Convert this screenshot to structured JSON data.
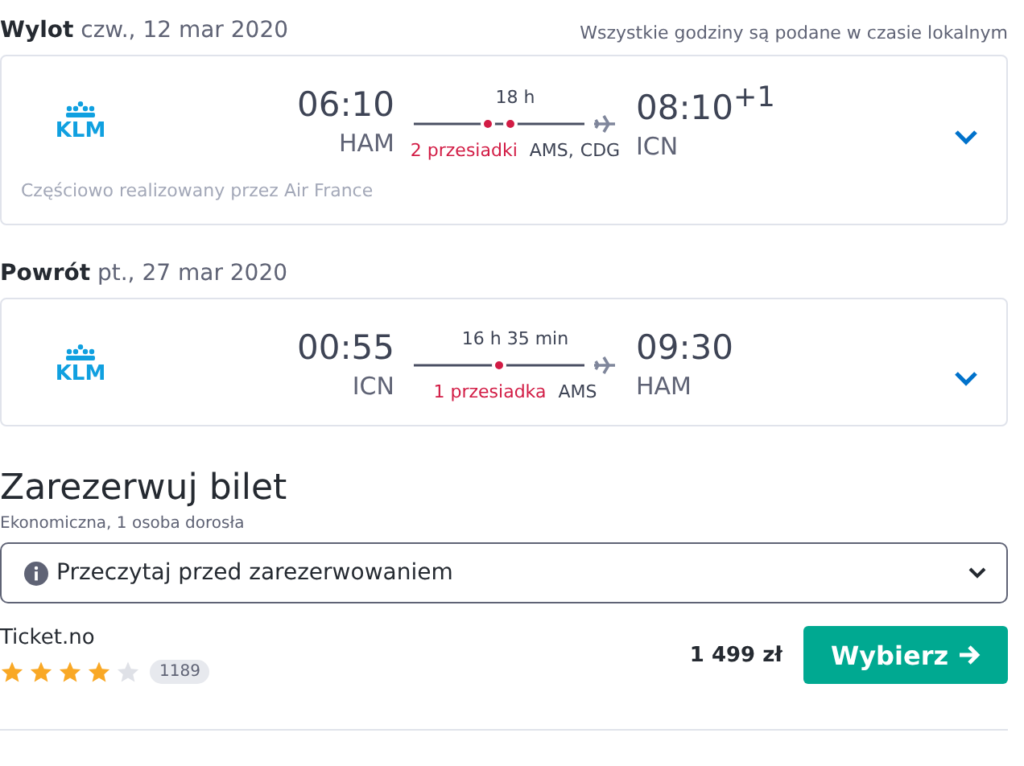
{
  "timezone_note": "Wszystkie godziny są podane w czasie lokalnym",
  "legs": [
    {
      "label": "Wylot",
      "date": "czw., 12 mar 2020",
      "airline": "KLM",
      "depart_time": "06:10",
      "depart_airport": "HAM",
      "duration": "18 h",
      "arrive_time": "08:10$^{+1}$",
      "arrive_airport": "ICN",
      "stops_text": "2 przesiadki",
      "stops": [
        "AMS,",
        "CDG"
      ],
      "operated_by": "Częściowo realizowany przez Air France",
      "expanded": false
    },
    {
      "label": "Powrót",
      "date": "pt., 27 mar 2020",
      "airline": "KLM",
      "depart_time": "00:55",
      "depart_airport": "ICN",
      "duration": "16 h 35 min",
      "arrive_time": "09:30",
      "arrive_airport": "HAM",
      "stops_text": "1 przesiadka",
      "stops": [
        "AMS"
      ],
      "expanded": false
    }
  ],
  "booking": {
    "title": "Zarezerwuj bilet",
    "subtitle": "Ekonomiczna, 1 osoba dorosła",
    "info": "Przeczytaj przed zarezerwowaniem",
    "provider": "Ticket.no",
    "stars": 4,
    "reviews": "1189",
    "price": "1 499 zł",
    "button": "Wybierz"
  }
}
